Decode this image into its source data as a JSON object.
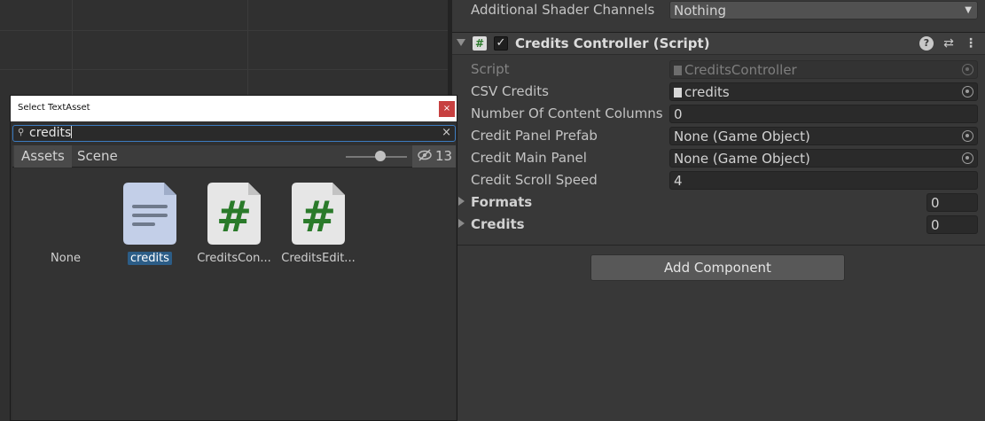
{
  "inspector": {
    "shader_row": {
      "label": "Additional Shader Channels",
      "value": "Nothing"
    },
    "component": {
      "title": "Credits Controller (Script)",
      "enabled": true
    },
    "fields": [
      {
        "label": "Script",
        "value": "CreditsController"
      },
      {
        "label": "CSV Credits",
        "value": "credits"
      },
      {
        "label": "Number Of Content Columns",
        "value": "0"
      },
      {
        "label": "Credit Panel Prefab",
        "value": "None (Game Object)"
      },
      {
        "label": "Credit Main Panel",
        "value": "None (Game Object)"
      },
      {
        "label": "Credit Scroll Speed",
        "value": "4"
      }
    ],
    "lists": [
      {
        "label": "Formats",
        "size": "0"
      },
      {
        "label": "Credits",
        "size": "0"
      }
    ],
    "add_component_label": "Add Component"
  },
  "dialog": {
    "title": "Select TextAsset",
    "close_symbol": "×",
    "search": {
      "value": "credits"
    },
    "tabs": [
      {
        "label": "Assets",
        "active": true
      },
      {
        "label": "Scene",
        "active": false
      }
    ],
    "hidden_count": "13",
    "items": [
      {
        "label": "None",
        "type": "none",
        "selected": false
      },
      {
        "label": "credits",
        "type": "text-file",
        "selected": true
      },
      {
        "label": "CreditsCon...",
        "type": "cs-script",
        "selected": false
      },
      {
        "label": "CreditsEdit...",
        "type": "cs-script",
        "selected": false
      }
    ]
  },
  "colors": {
    "selection": "#2c5d87",
    "script_green": "#2a7a2a",
    "close_red": "#c74040",
    "search_focus": "#3c7bc0"
  },
  "icons": [
    "script-icon",
    "checkbox-icon",
    "help-icon",
    "presets-icon",
    "more-menu-icon",
    "object-picker-icon",
    "search-icon",
    "clear-search-icon",
    "hidden-eye-icon",
    "text-file-icon",
    "csharp-script-icon"
  ]
}
